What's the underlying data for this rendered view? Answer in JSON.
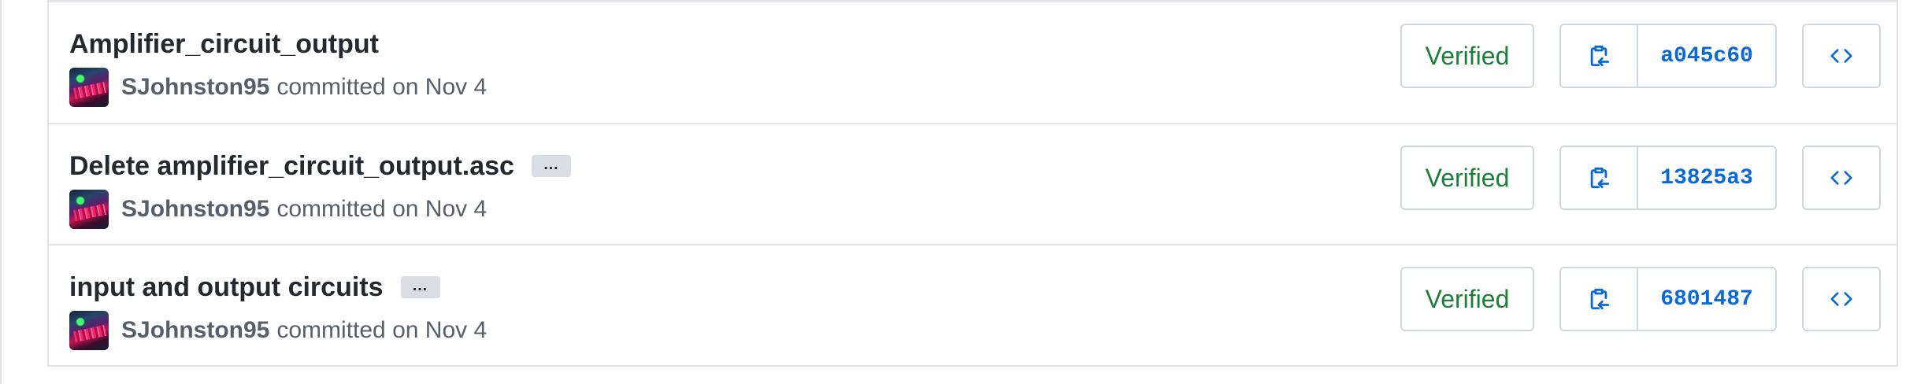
{
  "commits": [
    {
      "message": "Amplifier_circuit_output",
      "has_ellipsis": false,
      "author": "SJohnston95",
      "committed_text": "committed on Nov 4",
      "verified_label": "Verified",
      "sha": "a045c60"
    },
    {
      "message": "Delete amplifier_circuit_output.asc",
      "has_ellipsis": true,
      "ellipsis_label": "…",
      "author": "SJohnston95",
      "committed_text": "committed on Nov 4",
      "verified_label": "Verified",
      "sha": "13825a3"
    },
    {
      "message": "input and output circuits",
      "has_ellipsis": true,
      "ellipsis_label": "…",
      "author": "SJohnston95",
      "committed_text": "committed on Nov 4",
      "verified_label": "Verified",
      "sha": "6801487"
    }
  ],
  "icons": {
    "copy": "clipboard-copy-icon",
    "browse": "code-icon"
  },
  "colors": {
    "verified": "#1a7f37",
    "sha": "#0969da",
    "border": "#d0d7de",
    "meta_text": "#57606a"
  }
}
